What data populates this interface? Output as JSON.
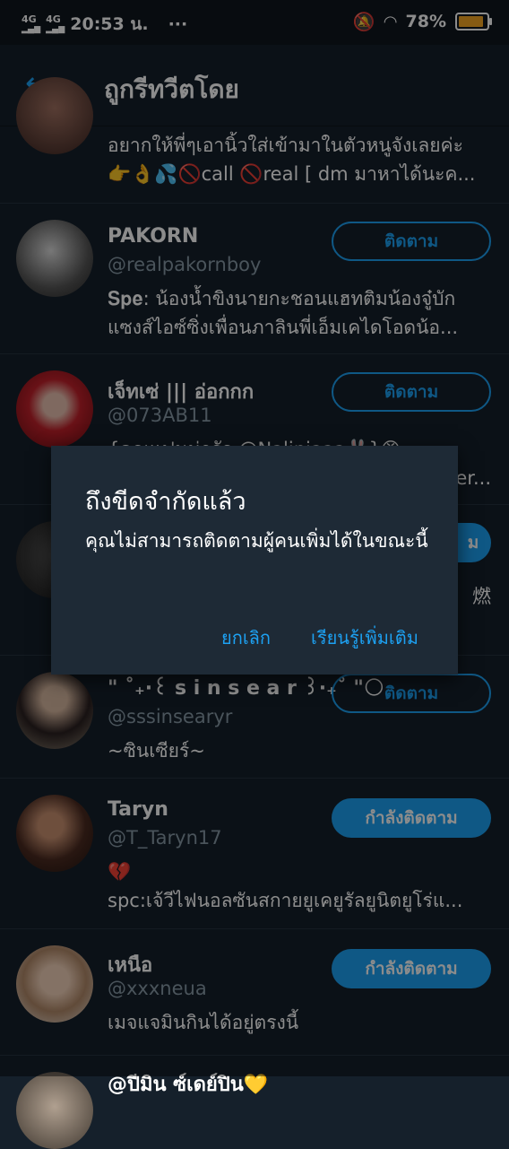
{
  "status_bar": {
    "net1": "4G",
    "net2": "4G",
    "time": "20:53 น.",
    "dots": "···",
    "battery": "78%",
    "battery_level": 0.78
  },
  "header": {
    "back_icon": "arrow-left-icon",
    "title": "ถูกรีทวีตโดย"
  },
  "users": [
    {
      "name": "",
      "handle": "",
      "bio_lines": [
        "อยากให้พี่ๆเอานิ้วใส่เข้ามาในตัวหนูจังเลยค่ะ",
        "👉👌💦🚫call 🚫real [ dm มาหาได้นะค..."
      ],
      "button": ""
    },
    {
      "name": "PAKORN",
      "handle": "@realpakornboy",
      "bio_lines": [
        "𝐒𝐩𝐞: น้องน้ำขิงนายกะชอนแฮทติมน้องจู๋บัก",
        "แซงส์ไอซ์ซิ่งเพื่อนภาลินพี่เอ็มเคไดโอดน้อ..."
      ],
      "button": "ติดตาม"
    },
    {
      "name": "เจ็ทเซ่ ||| อ่อกกก",
      "handle": "@073AB11",
      "bio_lines": [
        "{คุณแฟนน่ารัก @Nalinjaaa🐰}😡",
        "er..."
      ],
      "button": "ติดตาม"
    },
    {
      "name": "",
      "handle": "",
      "bio_lines": [
        "燃"
      ],
      "button": "ม"
    },
    {
      "name": "\" ˚₊·꒰ s i n s e a r ꒱·₊˚ \"🌕",
      "handle": "@sssinsearyr",
      "bio_lines": [
        "~ซินเซียร์~"
      ],
      "button": "ติดตาม"
    },
    {
      "name": "Taryn",
      "handle": "@T_Taryn17",
      "bio_lines": [
        "💔",
        "spc:เจ้วีไฟนอลซันสกายยูเคยูรัลยูนิตยูโร่แ..."
      ],
      "button": "กำลังติดตาม"
    },
    {
      "name": "เหนือ",
      "handle": "@xxxneua",
      "bio_lines": [
        "เมจแจมินกินได้อยู่ตรงนี้"
      ],
      "button": "กำลังติดตาม"
    },
    {
      "name": "@ปีมิน ซ์เดย์ปิน💛",
      "handle": "",
      "bio_lines": [],
      "button": ""
    }
  ],
  "dialog": {
    "title": "ถึงขีดจำกัดแล้ว",
    "message": "คุณไม่สามารถติดตามผู้คนเพิ่มได้ในขณะนี้",
    "cancel": "ยกเลิก",
    "learn_more": "เรียนรู้เพิ่มเติม"
  }
}
